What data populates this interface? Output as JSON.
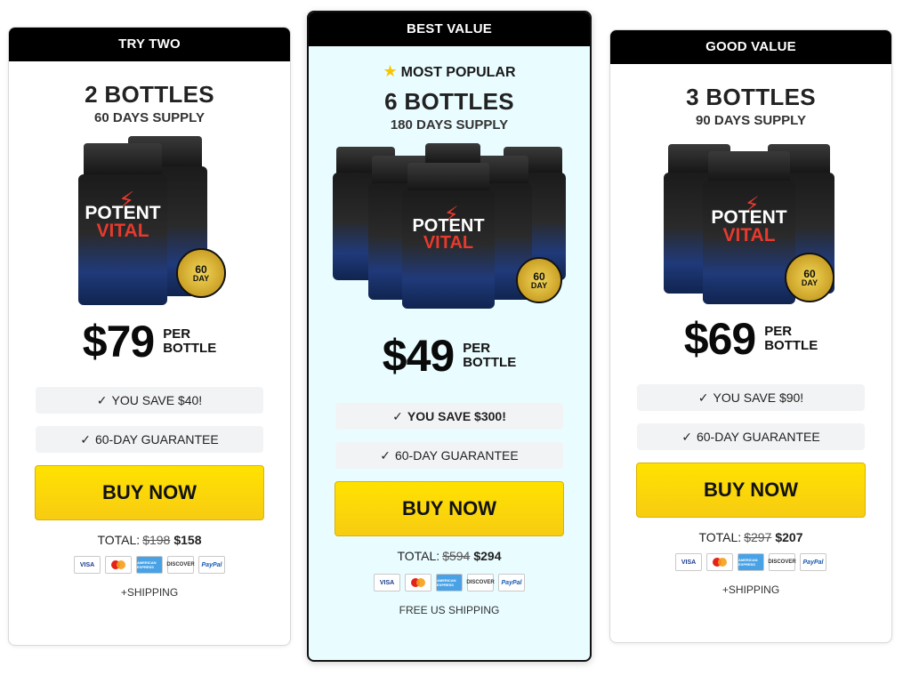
{
  "plans": [
    {
      "header": "TRY TWO",
      "popular": "",
      "bottles": "2 BOTTLES",
      "supply": "60 DAYS SUPPLY",
      "price": "$79",
      "per_line1": "PER",
      "per_line2": "BOTTLE",
      "save": "YOU SAVE $40!",
      "guarantee": "60-DAY GUARANTEE",
      "buy": "BUY NOW",
      "total_label": "TOTAL:",
      "old_total": "$198",
      "new_total": "$158",
      "shipping": "+SHIPPING"
    },
    {
      "header": "BEST VALUE",
      "popular": "MOST POPULAR",
      "bottles": "6 BOTTLES",
      "supply": "180 DAYS SUPPLY",
      "price": "$49",
      "per_line1": "PER",
      "per_line2": "BOTTLE",
      "save": "YOU SAVE $300!",
      "guarantee": "60-DAY GUARANTEE",
      "buy": "BUY NOW",
      "total_label": "TOTAL:",
      "old_total": "$594",
      "new_total": "$294",
      "shipping": "FREE US SHIPPING"
    },
    {
      "header": "GOOD VALUE",
      "popular": "",
      "bottles": "3 BOTTLES",
      "supply": "90 DAYS SUPPLY",
      "price": "$69",
      "per_line1": "PER",
      "per_line2": "BOTTLE",
      "save": "YOU SAVE $90!",
      "guarantee": "60-DAY GUARANTEE",
      "buy": "BUY NOW",
      "total_label": "TOTAL:",
      "old_total": "$297",
      "new_total": "$207",
      "shipping": "+SHIPPING"
    }
  ],
  "product": {
    "brand_top": "POTENT",
    "brand_bottom": "VITAL",
    "badge_top": "60",
    "badge_bottom": "DAY"
  },
  "payment": {
    "visa": "VISA",
    "mastercard": "MasterCard",
    "amex": "AMERICAN EXPRESS",
    "discover": "DISCOVER",
    "paypal": "PayPal"
  },
  "colors": {
    "featured_bg": "#e9fcff",
    "button": "#ffe200",
    "header": "#000000"
  }
}
